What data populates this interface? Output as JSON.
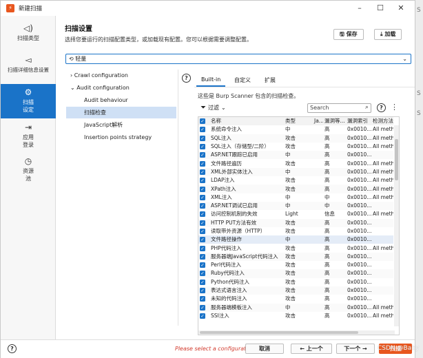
{
  "window": {
    "title": "新建扫描",
    "app_icon": "burp-icon",
    "accent": "#e8561e"
  },
  "sidebar": {
    "items": [
      {
        "label": "扫描类型",
        "icon": "scan-type-icon",
        "active": false
      },
      {
        "label": "扫描详细信息设置",
        "icon": "send-icon",
        "active": false
      },
      {
        "label": "扫描\n设定",
        "icon": "gear-icon",
        "active": true
      },
      {
        "label": "应用\n登录",
        "icon": "login-icon",
        "active": false
      },
      {
        "label": "资源\n池",
        "icon": "clock-icon",
        "active": false
      }
    ],
    "active_color": "#1a73c8"
  },
  "header": {
    "title": "扫描设置",
    "description": "选择您要运行的扫描配置类型，或加载现有配置。您可以根据需要调整配置。",
    "save_label": "保存",
    "load_label": "加载"
  },
  "preset": {
    "value": "轻量"
  },
  "tree": {
    "items": [
      {
        "label": "Crawl configuration",
        "expander": "›",
        "level": 0
      },
      {
        "label": "Audit configuration",
        "expander": "⌄",
        "level": 0
      },
      {
        "label": "Audit behaviour",
        "level": 1
      },
      {
        "label": "扫描检查",
        "level": 1,
        "selected": true
      },
      {
        "label": "JavaScript解析",
        "level": 1
      },
      {
        "label": "Insertion points strategy",
        "level": 1
      }
    ]
  },
  "tabs": [
    {
      "label": "Built-in",
      "active": true
    },
    {
      "label": "自定义",
      "active": false
    },
    {
      "label": "扩展",
      "active": false
    }
  ],
  "checks_description": "这些是 Burp Scanner 包含的扫描检查。",
  "filter_label": "过滤",
  "search": {
    "placeholder": "Search"
  },
  "table": {
    "headers": [
      "名称",
      "类型",
      "Ja...",
      "漏洞等...",
      "漏洞索引",
      "检测方法"
    ],
    "rows": [
      [
        "系统命令注入",
        "中",
        "",
        "高",
        "0x0010...",
        "All meth"
      ],
      [
        "SQL注入",
        "攻击",
        "",
        "高",
        "0x0010...",
        "All meth"
      ],
      [
        "SQL注入（存储型/二阶）",
        "攻击",
        "",
        "高",
        "0x0010...",
        "All meth"
      ],
      [
        "ASP.NET跟踪已启用",
        "中",
        "",
        "高",
        "0x0010...",
        ""
      ],
      [
        "文件路径遍历",
        "攻击",
        "",
        "高",
        "0x0010...",
        "All meth"
      ],
      [
        "XML外部实体注入",
        "中",
        "",
        "高",
        "0x0010...",
        "All meth"
      ],
      [
        "LDAP注入",
        "攻击",
        "",
        "高",
        "0x0010...",
        "All meth"
      ],
      [
        "XPath注入",
        "攻击",
        "",
        "高",
        "0x0010...",
        "All meth"
      ],
      [
        "XML注入",
        "中",
        "",
        "中",
        "0x0010...",
        "All meth"
      ],
      [
        "ASP.NET调试已启用",
        "中",
        "",
        "中",
        "0x0010...",
        ""
      ],
      [
        "访问控制机制的失效",
        "Light",
        "",
        "信息",
        "0x0010...",
        "All meth"
      ],
      [
        "HTTP PUT方法有效",
        "攻击",
        "",
        "高",
        "0x0010...",
        ""
      ],
      [
        "读取带外资源（HTTP）",
        "攻击",
        "",
        "高",
        "0x0010...",
        ""
      ],
      [
        "文件路径操作",
        "中",
        "",
        "高",
        "0x0010...",
        ""
      ],
      [
        "PHP代码注入",
        "攻击",
        "",
        "高",
        "0x0010...",
        "All meth"
      ],
      [
        "服务器端JavaScript代码注入",
        "攻击",
        "",
        "高",
        "0x0010...",
        ""
      ],
      [
        "Perl代码注入",
        "攻击",
        "",
        "高",
        "0x0010...",
        ""
      ],
      [
        "Ruby代码注入",
        "攻击",
        "",
        "高",
        "0x0010...",
        ""
      ],
      [
        "Python代码注入",
        "攻击",
        "",
        "高",
        "0x0010...",
        ""
      ],
      [
        "表达式语言注入",
        "攻击",
        "",
        "高",
        "0x0010...",
        ""
      ],
      [
        "未知的代码注入",
        "攻击",
        "",
        "高",
        "0x0010...",
        ""
      ],
      [
        "服务器端模板注入",
        "中",
        "",
        "高",
        "0x0010...",
        "All meth"
      ],
      [
        "SSI注入",
        "攻击",
        "",
        "高",
        "0x0010...",
        "All meth"
      ]
    ],
    "highlight_row": 13
  },
  "footer": {
    "message": "Please select a configuration",
    "cancel_label": "取消",
    "prev_label": "← 上一个",
    "next_label": "下一个 →",
    "finish_label": "扫描"
  },
  "background": {
    "chars": [
      "S",
      "S",
      "S"
    ]
  },
  "watermark": "CSDN @Baby"
}
